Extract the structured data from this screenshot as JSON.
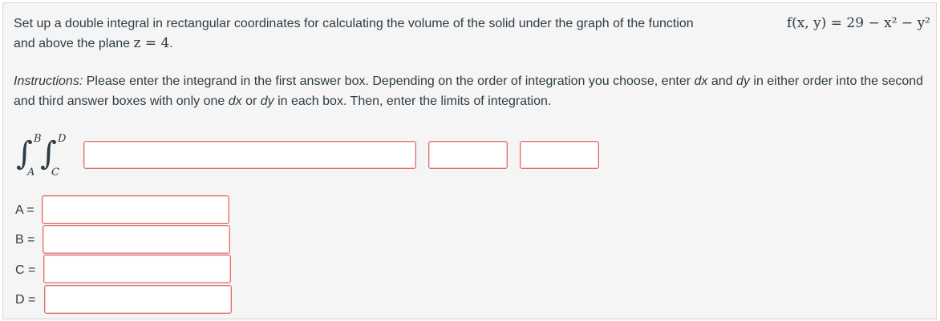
{
  "question": {
    "text_before": "Set up a double integral in rectangular coordinates for calculating the volume of the solid under the graph of the function ",
    "function_label": "f(x, y) = 29 − x² − y²",
    "text_middle": "and above the plane ",
    "plane_label": "z = 4",
    "text_end": "."
  },
  "instructions": {
    "lead": "Instructions:",
    "part1": " Please enter the integrand in the first answer box. Depending on the order of integration you choose, enter ",
    "dx1": "dx",
    "and": " and ",
    "dy1": "dy",
    "part2": " in either order into the second and third answer boxes with only one ",
    "dx2": "dx",
    "or": " or ",
    "dy2": "dy",
    "part3": " in each box. Then, enter the limits of integration."
  },
  "integral": {
    "outer_upper": "B",
    "outer_lower": "A",
    "inner_upper": "D",
    "inner_lower": "C",
    "integrand_value": "",
    "diff1_value": "",
    "diff2_value": ""
  },
  "limits": [
    {
      "label": "A =",
      "value": ""
    },
    {
      "label": "B =",
      "value": ""
    },
    {
      "label": "C =",
      "value": ""
    },
    {
      "label": "D =",
      "value": ""
    }
  ],
  "colors": {
    "panel_bg": "#f5f5f5",
    "text": "#2d3b45",
    "box_border_invalid": "#e07070"
  }
}
